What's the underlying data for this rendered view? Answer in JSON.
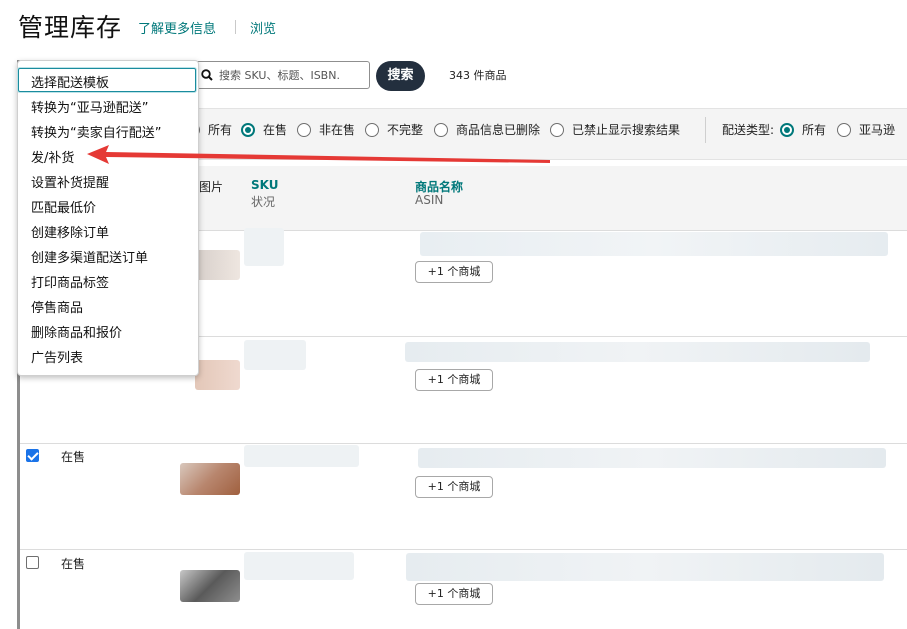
{
  "header": {
    "title": "管理库存",
    "learn_more": "了解更多信息",
    "browse": "浏览"
  },
  "search": {
    "placeholder": "搜索 SKU、标题、ISBN.",
    "button": "搜索",
    "count": "343 件商品"
  },
  "filters": {
    "status_options": [
      {
        "label": "所有",
        "selected": false
      },
      {
        "label": "在售",
        "selected": true
      },
      {
        "label": "非在售",
        "selected": false
      },
      {
        "label": "不完整",
        "selected": false
      },
      {
        "label": "商品信息已删除",
        "selected": false
      },
      {
        "label": "已禁止显示搜索结果",
        "selected": false
      }
    ],
    "fulfillment_label": "配送类型:",
    "fulfillment_options": [
      {
        "label": "所有",
        "selected": true
      },
      {
        "label": "亚马逊",
        "selected": false
      }
    ]
  },
  "table": {
    "columns": {
      "image": "图片",
      "sku": "SKU",
      "status": "状况",
      "name": "商品名称",
      "asin": "ASIN"
    },
    "rows": [
      {
        "checked": null,
        "status": "",
        "marketplace": "+1 个商城"
      },
      {
        "checked": null,
        "status": "",
        "marketplace": "+1 个商城"
      },
      {
        "checked": true,
        "status": "在售",
        "marketplace": "+1 个商城"
      },
      {
        "checked": false,
        "status": "在售",
        "marketplace": "+1 个商城"
      }
    ]
  },
  "menu": {
    "items": [
      "选择配送模板",
      "转换为“亚马逊配送”",
      "转换为“卖家自行配送”",
      "发/补货",
      "设置补货提醒",
      "匹配最低价",
      "创建移除订单",
      "创建多渠道配送订单",
      "打印商品标签",
      "停售商品",
      "删除商品和报价",
      "广告列表"
    ],
    "highlighted_index": 0,
    "annotated_index": 3
  },
  "colors": {
    "accent": "#00787a",
    "search_button": "#232f3e",
    "annotation_arrow": "#e53935",
    "checkbox": "#1a73e8"
  }
}
